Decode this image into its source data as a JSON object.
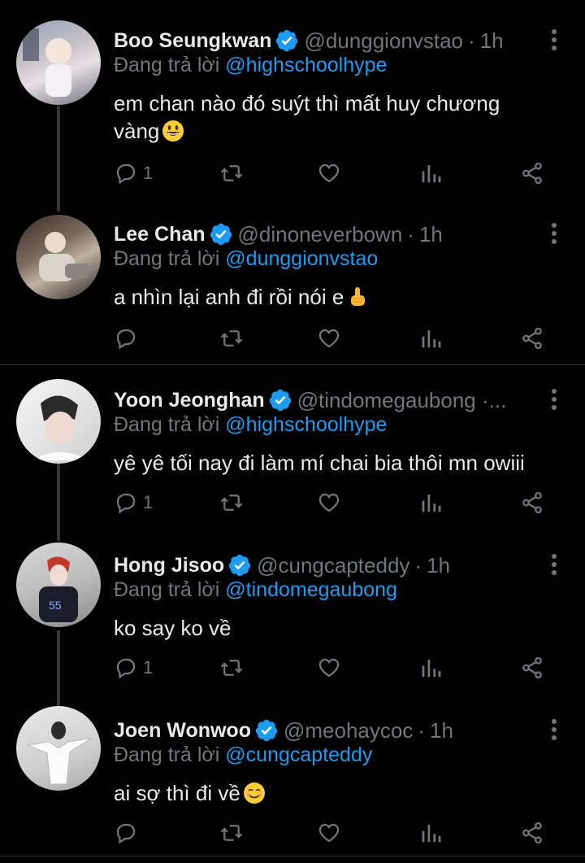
{
  "tweets": [
    {
      "name": "Boo Seungkwan",
      "handle": "@dunggionvstao",
      "sep": "·",
      "time": "1h",
      "replying_prefix": "Đang trả lời",
      "replying_to": "@highschoolhype",
      "text_line1": "em chan nào đó suýt thì mất huy chương",
      "text_line2": "vàng",
      "emoji": "grinning-face-emoji",
      "reply_count": "1",
      "avatar": "avatar-photo"
    },
    {
      "name": "Lee Chan",
      "handle": "@dinoneverbown",
      "sep": "·",
      "time": "1h",
      "replying_prefix": "Đang trả lời",
      "replying_to": "@dunggionvstao",
      "text_line1": "a nhìn lại anh đi rồi nói e",
      "emoji": "pointing-finger-emoji",
      "reply_count": "",
      "avatar": "avatar-photo"
    },
    {
      "name": "Yoon Jeonghan",
      "handle": "@tindomegaubong ·...",
      "replying_prefix": "Đang trả lời",
      "replying_to": "@highschoolhype",
      "text_line1": "yê yê tối nay đi làm mí chai bia thôi mn owiii",
      "reply_count": "1",
      "avatar": "avatar-photo"
    },
    {
      "name": "Hong Jisoo",
      "handle": "@cungcapteddy",
      "sep": "·",
      "time": "1h",
      "replying_prefix": "Đang trả lời",
      "replying_to": "@tindomegaubong",
      "text_line1": "ko say ko về",
      "reply_count": "1",
      "avatar": "avatar-photo"
    },
    {
      "name": "Joen Wonwoo",
      "handle": "@meohaycoc",
      "sep": "·",
      "time": "1h",
      "replying_prefix": "Đang trả lời",
      "replying_to": "@cungcapteddy",
      "text_line1": "ai sợ thì đi về",
      "emoji": "smiling-face-emoji",
      "reply_count": "",
      "avatar": "avatar-photo"
    }
  ],
  "colors": {
    "background": "#000000",
    "text": "#e7e9ea",
    "muted": "#71767b",
    "link": "#1d9bf0",
    "verified": "#1d9bf0"
  },
  "icons": [
    "reply-icon",
    "retweet-icon",
    "like-icon",
    "analytics-icon",
    "share-icon",
    "verified-icon",
    "more-icon"
  ]
}
